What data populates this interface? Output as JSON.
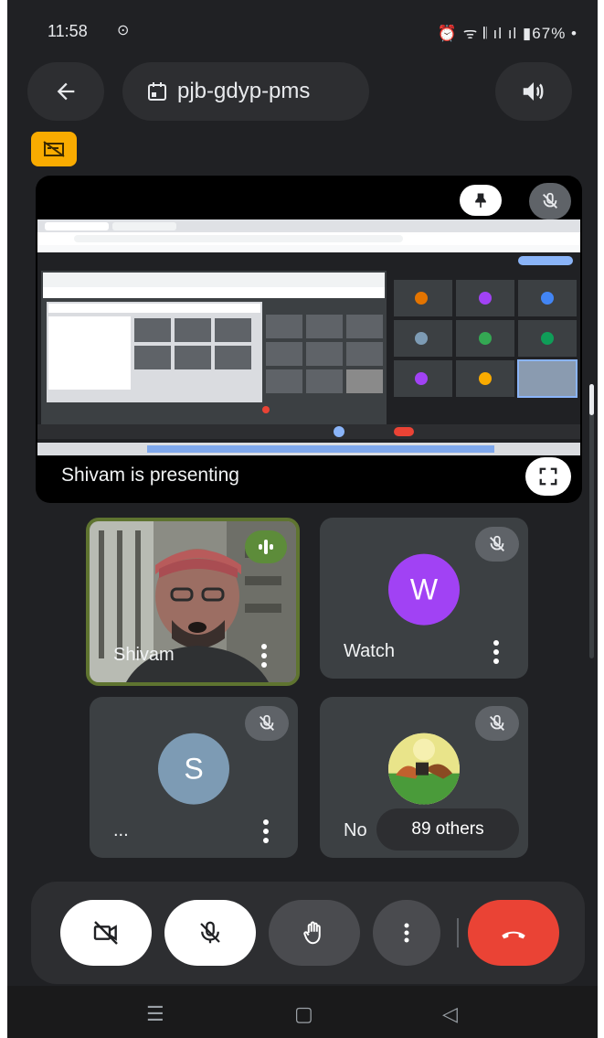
{
  "status_bar": {
    "time": "11:58",
    "right_text": "67%"
  },
  "top_bar": {
    "meeting_code": "pjb-gdyp-pms",
    "back_icon": "arrow-back-icon",
    "calendar_icon": "calendar-icon",
    "speaker_icon": "speaker-icon"
  },
  "presentation": {
    "presenter_label": "Shivam is presenting"
  },
  "participants": [
    {
      "name": "Shivam",
      "avatar_letter": "",
      "speaking": true
    },
    {
      "name": "Watch",
      "avatar_letter": "W",
      "avatar_color": "#a142f4",
      "muted": true
    },
    {
      "name": "...",
      "avatar_letter": "S",
      "avatar_color": "#7d9bb4",
      "muted": true
    },
    {
      "name": "No",
      "avatar_letter": "",
      "muted": true
    }
  ],
  "others_label": "89 others",
  "controls": {
    "camera_icon": "camera-off-icon",
    "mic_icon": "mic-off-icon",
    "hand_icon": "raise-hand-icon",
    "more_icon": "more-vert-icon",
    "end_call_icon": "end-call-icon",
    "end_call_color": "#ea4335"
  }
}
